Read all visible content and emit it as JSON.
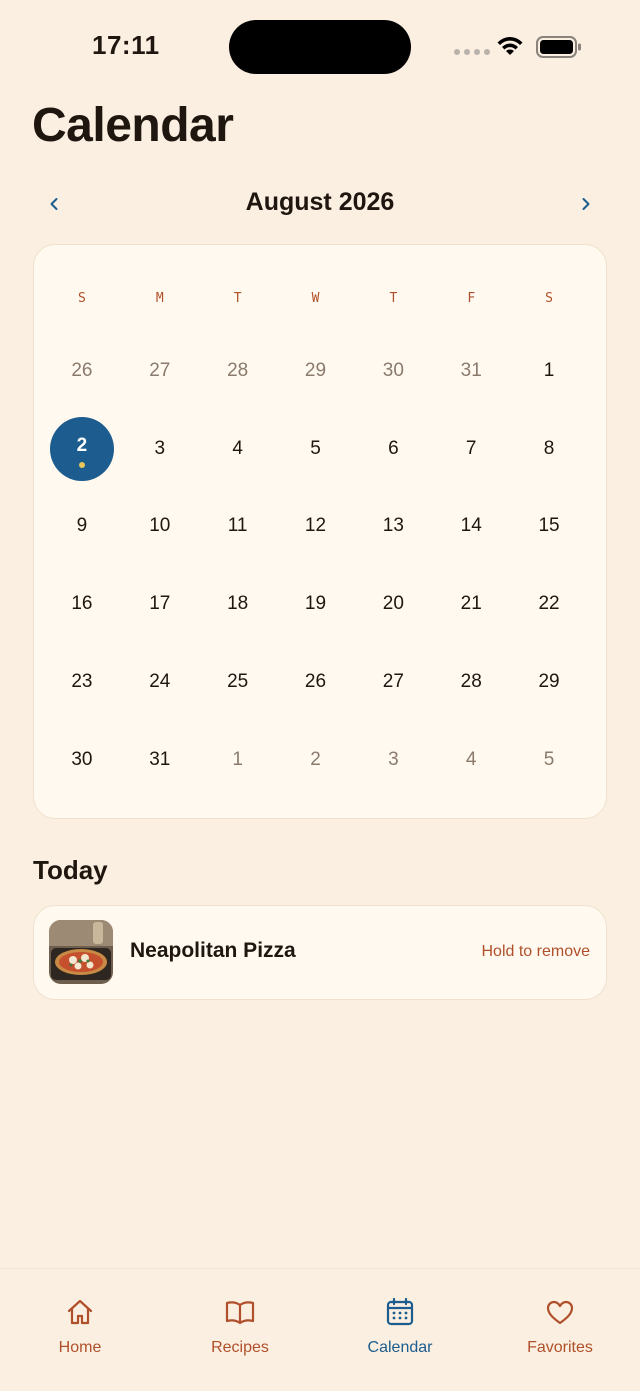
{
  "status_bar": {
    "time": "17:11"
  },
  "page": {
    "title": "Calendar"
  },
  "month_nav": {
    "prev": "‹",
    "label": "August 2026",
    "next": "›"
  },
  "calendar": {
    "weekdays": [
      "S",
      "M",
      "T",
      "W",
      "T",
      "F",
      "S"
    ],
    "days": [
      {
        "n": "26",
        "muted": true
      },
      {
        "n": "27",
        "muted": true
      },
      {
        "n": "28",
        "muted": true
      },
      {
        "n": "29",
        "muted": true
      },
      {
        "n": "30",
        "muted": true
      },
      {
        "n": "31",
        "muted": true
      },
      {
        "n": "1"
      },
      {
        "n": "2",
        "selected": true,
        "has_meal": true
      },
      {
        "n": "3"
      },
      {
        "n": "4"
      },
      {
        "n": "5"
      },
      {
        "n": "6"
      },
      {
        "n": "7"
      },
      {
        "n": "8"
      },
      {
        "n": "9"
      },
      {
        "n": "10"
      },
      {
        "n": "11"
      },
      {
        "n": "12"
      },
      {
        "n": "13"
      },
      {
        "n": "14"
      },
      {
        "n": "15"
      },
      {
        "n": "16"
      },
      {
        "n": "17"
      },
      {
        "n": "18"
      },
      {
        "n": "19"
      },
      {
        "n": "20"
      },
      {
        "n": "21"
      },
      {
        "n": "22"
      },
      {
        "n": "23"
      },
      {
        "n": "24"
      },
      {
        "n": "25"
      },
      {
        "n": "26"
      },
      {
        "n": "27"
      },
      {
        "n": "28"
      },
      {
        "n": "29"
      },
      {
        "n": "30"
      },
      {
        "n": "31"
      },
      {
        "n": "1",
        "muted": true
      },
      {
        "n": "2",
        "muted": true
      },
      {
        "n": "3",
        "muted": true
      },
      {
        "n": "4",
        "muted": true
      },
      {
        "n": "5",
        "muted": true
      }
    ]
  },
  "today": {
    "title": "Today",
    "meal": {
      "name": "Neapolitan Pizza",
      "hint": "Hold to remove",
      "image_icon": "pizza-photo"
    }
  },
  "tab_bar": {
    "tabs": [
      {
        "label": "Home",
        "icon": "home-icon",
        "active": false
      },
      {
        "label": "Recipes",
        "icon": "book-icon",
        "active": false
      },
      {
        "label": "Calendar",
        "icon": "calendar-icon",
        "active": true
      },
      {
        "label": "Favorites",
        "icon": "heart-icon",
        "active": false
      }
    ]
  },
  "colors": {
    "background": "#FAEFE1",
    "card": "#FFF9F0",
    "accent_blue": "#1D5C8E",
    "accent_rust": "#B0502A",
    "meal_dot": "#E9C65A"
  }
}
